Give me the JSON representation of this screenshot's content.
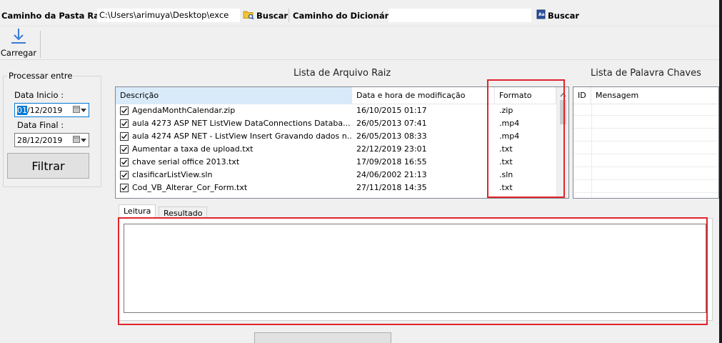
{
  "topbar": {
    "root_label": "Caminho da Pasta Raiz :",
    "root_path": "C:\\Users\\arimuya\\Desktop\\exce",
    "buscar1": "Buscar",
    "dict_label": "Caminho do Dicionário :",
    "dict_path": "",
    "buscar2": "Buscar"
  },
  "toolbar": {
    "carregar": "Carregar"
  },
  "group": {
    "legend": "Processar entre",
    "start_label": "Data Inicio :",
    "start_day": "01",
    "start_rest": "/12/2019",
    "end_label": "Data Final :",
    "end_value": "28/12/2019",
    "filtrar": "Filtrar"
  },
  "files": {
    "title": "Lista de Arquivo Raiz",
    "columns": [
      "Descrição",
      "Data e hora de modificação",
      "Formato"
    ],
    "rows": [
      {
        "name": "AgendaMonthCalendar.zip",
        "date": "16/10/2015 01:17",
        "format": ".zip"
      },
      {
        "name": "aula 4273 ASP NET    ListView DataConnections Databa...",
        "date": "26/05/2013 07:41",
        "format": ".mp4"
      },
      {
        "name": "aula 4274 ASP NET -  ListView Insert Gravando dados n...",
        "date": "26/05/2013 08:33",
        "format": ".mp4"
      },
      {
        "name": "Aumentar a taxa de upload.txt",
        "date": "22/12/2019 23:01",
        "format": ".txt"
      },
      {
        "name": "chave serial office 2013.txt",
        "date": "17/09/2018 16:55",
        "format": ".txt"
      },
      {
        "name": "clasificarListView.sln",
        "date": "24/06/2002 21:13",
        "format": ".sln"
      },
      {
        "name": "Cod_VB_Alterar_Cor_Form.txt",
        "date": "27/11/2018 14:35",
        "format": ".txt"
      }
    ]
  },
  "keywords": {
    "title": "Lista de Palavra Chaves",
    "columns": [
      "ID",
      "Mensagem"
    ]
  },
  "tabs": [
    "Leitura",
    "Resultado"
  ],
  "colors": {
    "accent": "#0078d7",
    "highlight": "#e0242b"
  }
}
